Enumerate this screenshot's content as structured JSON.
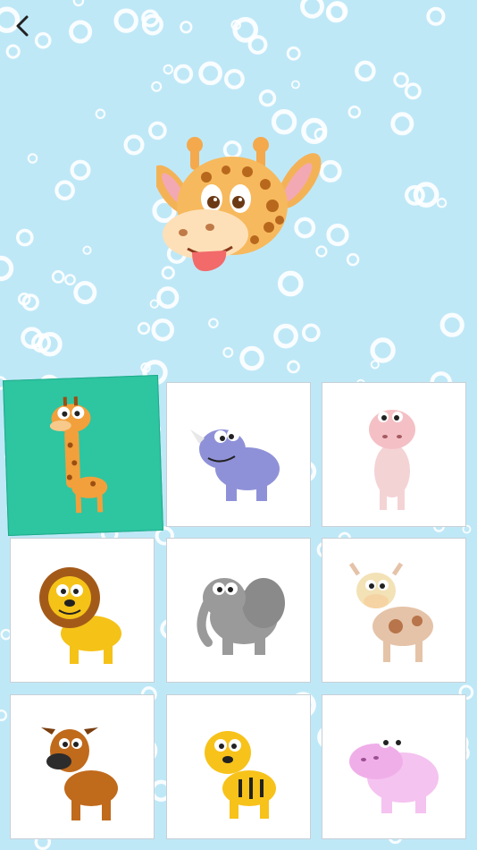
{
  "app": {
    "background_color": "#bfe8f7",
    "bubble_color": "#ffffff"
  },
  "header": {
    "back_icon": "chevron-left-icon"
  },
  "hero": {
    "animal": "giraffe",
    "icon": "giraffe-head-icon"
  },
  "grid": {
    "selected_index": 0,
    "selected_color": "#2ec5a1",
    "items": [
      {
        "animal": "giraffe",
        "icon": "giraffe-icon"
      },
      {
        "animal": "rhino",
        "icon": "rhino-icon"
      },
      {
        "animal": "hippo",
        "icon": "hippo-standing-icon"
      },
      {
        "animal": "lion",
        "icon": "lion-icon"
      },
      {
        "animal": "elephant",
        "icon": "elephant-icon"
      },
      {
        "animal": "cow",
        "icon": "cow-icon"
      },
      {
        "animal": "dog",
        "icon": "dog-icon"
      },
      {
        "animal": "tiger",
        "icon": "tiger-icon"
      },
      {
        "animal": "hippo",
        "icon": "hippo-icon"
      }
    ]
  }
}
